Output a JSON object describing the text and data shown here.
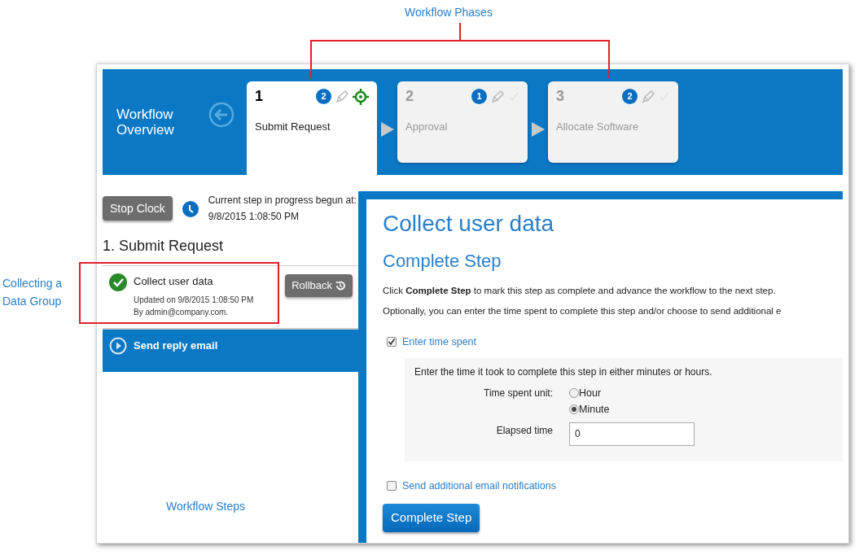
{
  "annotations": [
    {
      "kind": "top",
      "label": "Workflow Phases"
    },
    {
      "kind": "left",
      "label": "Collecting a Data Group"
    },
    {
      "kind": "inline",
      "label": "Workflow Steps"
    }
  ],
  "header": {
    "title": "Workflow Overview"
  },
  "phases": [
    {
      "number": "1",
      "name": "Submit Request",
      "count": "2",
      "selected": true,
      "current": true
    },
    {
      "number": "2",
      "name": "Approval",
      "count": "1",
      "selected": false,
      "current": false
    },
    {
      "number": "3",
      "name": "Allocate Software",
      "count": "2",
      "selected": false,
      "current": false
    }
  ],
  "sidebar": {
    "stop_button": "Stop Clock",
    "clock_text": "Current step in progress begun at:",
    "clock_time": "9/8/2015 1:08:50 PM",
    "phase_title": "1. Submit Request",
    "steps": [
      {
        "kind": "done",
        "title": "Collect user data",
        "updated": "Updated on 9/8/2015 1:08:50 PM",
        "by": "By admin@company.com.",
        "button": "Rollback"
      },
      {
        "kind": "pending",
        "title": "Send reply email"
      }
    ]
  },
  "content": {
    "title": "Collect user data",
    "subtitle": "Complete Step",
    "paragraphs": [
      "Click **Complete Step** to mark this step as complete and advance the workflow to the next step.",
      "Optionally, you can enter the time spent to complete this step and/or choose to send additional e"
    ],
    "time_option": {
      "label": "Enter time spent",
      "checked": true
    },
    "time_panel": {
      "hint": "Enter the time it took to complete this step in either minutes or hours.",
      "unit_label": "Time spent unit:",
      "units": [
        {
          "label": "Hour",
          "selected": false
        },
        {
          "label": "Minute",
          "selected": true
        }
      ],
      "elapsed_label": "Elapsed time",
      "elapsed_value": "0"
    },
    "email_option": {
      "label": "Send additional email notifications",
      "checked": false
    },
    "button": "Complete Step"
  }
}
